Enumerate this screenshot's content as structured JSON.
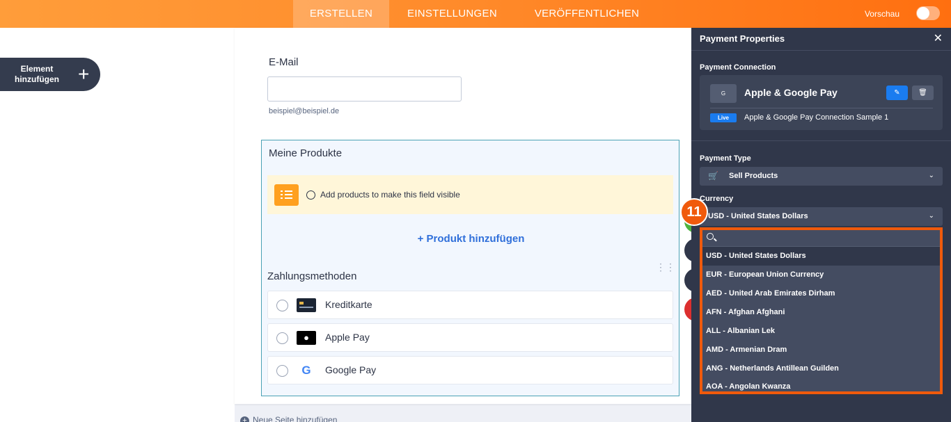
{
  "topbar": {
    "tabs": [
      {
        "label": "ERSTELLEN",
        "active": true
      },
      {
        "label": "EINSTELLUNGEN",
        "active": false
      },
      {
        "label": "VERÖFFENTLICHEN",
        "active": false
      }
    ],
    "preview_label": "Vorschau",
    "preview_on": false
  },
  "sidebar": {
    "add_element_label": "Element hinzufügen"
  },
  "form": {
    "email_label": "E-Mail",
    "email_value": "",
    "email_hint": "beispiel@beispiel.de",
    "products_title": "Meine Produkte",
    "notice_text": "Add products to make this field visible",
    "add_product": "+ Produkt hinzufügen",
    "payment_methods_title": "Zahlungsmethoden",
    "payment_methods": [
      {
        "label": "Kreditkarte",
        "icon": "credit-card-icon"
      },
      {
        "label": "Apple Pay",
        "icon": "apple-icon"
      },
      {
        "label": "Google Pay",
        "icon": "google-icon"
      }
    ],
    "new_page": "Neue Seite hinzufügen"
  },
  "properties": {
    "title": "Payment Properties",
    "connection_label": "Payment Connection",
    "connection_name": "Apple & Google Pay",
    "connection_logo": "G",
    "live_badge": "Live",
    "connection_sample": "Apple & Google Pay Connection Sample 1",
    "payment_type_label": "Payment Type",
    "payment_type_value": "Sell Products",
    "currency_label": "Currency",
    "currency_value": "USD - United States Dollars",
    "search_placeholder": "",
    "currency_options": [
      "USD - United States Dollars",
      "EUR - European Union Currency",
      "AED - United Arab Emirates Dirham",
      "AFN - Afghan Afghani",
      "ALL - Albanian Lek",
      "AMD - Armenian Dram",
      "ANG - Netherlands Antillean Guilden",
      "AOA - Angolan Kwanza"
    ]
  },
  "annotation_badge": "11",
  "colors": {
    "accent": "#ff8a2a",
    "panel": "#30374a",
    "highlight_border": "#f05a0c",
    "link": "#2f6fda"
  }
}
